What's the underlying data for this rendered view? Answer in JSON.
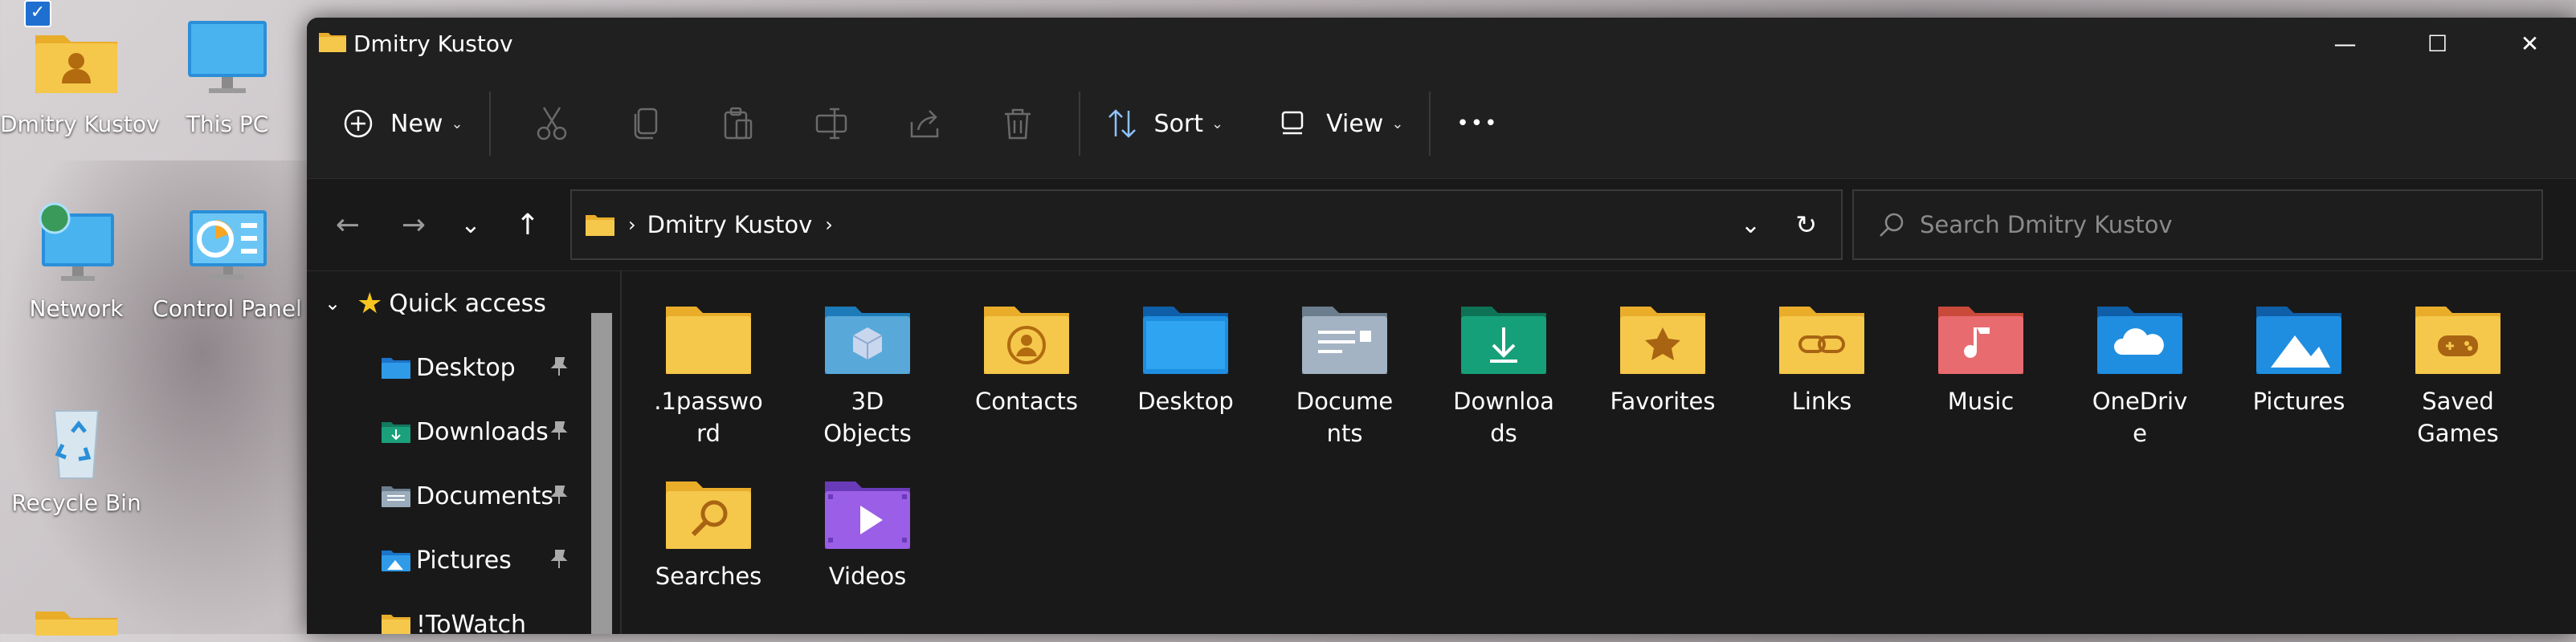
{
  "desktop": {
    "icons": [
      {
        "label": "Dmitry Kustov",
        "selected_mark": "✓"
      },
      {
        "label": "This PC"
      },
      {
        "label": "Network"
      },
      {
        "label": "Control Panel"
      },
      {
        "label": "Recycle Bin"
      }
    ]
  },
  "window": {
    "title": "Dmitry Kustov",
    "controls": {
      "minimize": "—",
      "maximize": "☐",
      "close": "✕"
    }
  },
  "toolbar": {
    "new_label": "New",
    "sort_label": "Sort",
    "view_label": "View",
    "more_label": "•••"
  },
  "navigation": {
    "back": "←",
    "forward": "→",
    "recent": "⌄",
    "up": "↑",
    "breadcrumb": [
      "Dmitry Kustov"
    ],
    "search_placeholder": "Search Dmitry Kustov"
  },
  "sidebar": {
    "header": "Quick access",
    "items": [
      {
        "label": "Desktop",
        "pinned": true
      },
      {
        "label": "Downloads",
        "pinned": true
      },
      {
        "label": "Documents",
        "pinned": true
      },
      {
        "label": "Pictures",
        "pinned": true
      },
      {
        "label": "!ToWatch",
        "pinned": false
      }
    ]
  },
  "folders": [
    {
      "label": ".1password",
      "lines": [
        ".1passwo",
        "rd"
      ]
    },
    {
      "label": "3D Objects",
      "lines": [
        "3D",
        "Objects"
      ]
    },
    {
      "label": "Contacts",
      "lines": [
        "Contacts"
      ]
    },
    {
      "label": "Desktop",
      "lines": [
        "Desktop"
      ]
    },
    {
      "label": "Documents",
      "lines": [
        "Docume",
        "nts"
      ]
    },
    {
      "label": "Downloads",
      "lines": [
        "Downloa",
        "ds"
      ]
    },
    {
      "label": "Favorites",
      "lines": [
        "Favorites"
      ]
    },
    {
      "label": "Links",
      "lines": [
        "Links"
      ]
    },
    {
      "label": "Music",
      "lines": [
        "Music"
      ]
    },
    {
      "label": "OneDrive",
      "lines": [
        "OneDriv",
        "e"
      ]
    },
    {
      "label": "Pictures",
      "lines": [
        "Pictures"
      ]
    },
    {
      "label": "Saved Games",
      "lines": [
        "Saved",
        "Games"
      ]
    },
    {
      "label": "Searches",
      "lines": [
        "Searches"
      ]
    },
    {
      "label": "Videos",
      "lines": [
        "Videos"
      ]
    }
  ],
  "colors": {
    "accent": "#1f6fd1",
    "folder_yellow": "#f5c84c",
    "window_bg": "#191919"
  }
}
